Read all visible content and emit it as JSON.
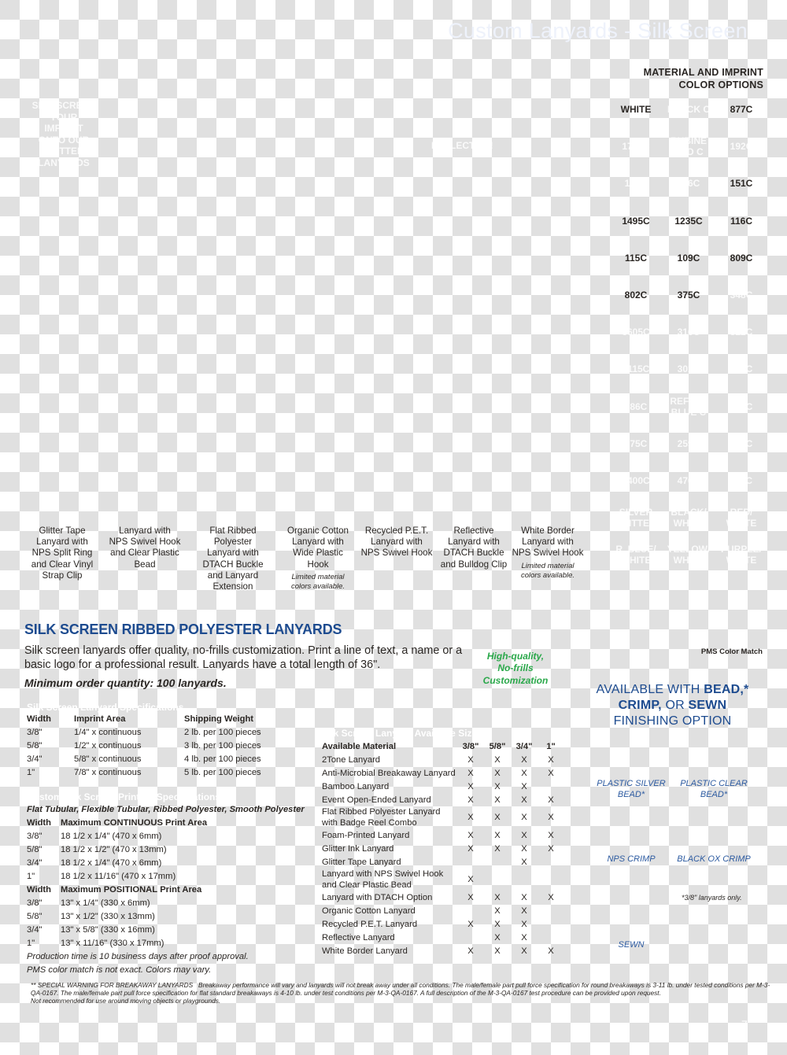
{
  "page_title": "Custom Lanyards - Silk Screen",
  "page_number": "7",
  "side_promo_ghost": [
    "SILK SCREEN",
    "YOUR",
    "IMPRINT",
    "ONTO OUR",
    "GLITTER",
    "LANYARDS"
  ],
  "reflective_ghost": "REFLECTIVE!",
  "color_options": {
    "heading_line1": "MATERIAL AND IMPRINT",
    "heading_line2": "COLOR OPTIONS",
    "rows": [
      [
        {
          "label": "WHITE",
          "visible": true
        },
        {
          "label": "BLACK C",
          "visible": false
        },
        {
          "label": "877C",
          "visible": true
        }
      ],
      [
        {
          "label": "1795C",
          "visible": false
        },
        {
          "label": "RUBINE RED C",
          "visible": false
        },
        {
          "label": "192C",
          "visible": false
        }
      ],
      [
        {
          "label": "187C",
          "visible": false
        },
        {
          "label": "186C",
          "visible": false
        },
        {
          "label": "151C",
          "visible": true
        }
      ],
      [
        {
          "label": "1495C",
          "visible": true
        },
        {
          "label": "1235C",
          "visible": true
        },
        {
          "label": "116C",
          "visible": true
        }
      ],
      [
        {
          "label": "115C",
          "visible": true
        },
        {
          "label": "109C",
          "visible": true
        },
        {
          "label": "809C",
          "visible": true
        }
      ],
      [
        {
          "label": "802C",
          "visible": true
        },
        {
          "label": "375C",
          "visible": true
        },
        {
          "label": "348C",
          "visible": false
        }
      ],
      [
        {
          "label": "5605C",
          "visible": false
        },
        {
          "label": "316C",
          "visible": false
        },
        {
          "label": "322C",
          "visible": false
        }
      ],
      [
        {
          "label": "3115C",
          "visible": false
        },
        {
          "label": "301C",
          "visible": false
        },
        {
          "label": "292C",
          "visible": false
        }
      ],
      [
        {
          "label": "286C",
          "visible": false
        },
        {
          "label": "REFLEX BLUE C",
          "visible": false
        },
        {
          "label": "072C",
          "visible": false
        }
      ],
      [
        {
          "label": "275C",
          "visible": false
        },
        {
          "label": "259C",
          "visible": false
        },
        {
          "label": "268C",
          "visible": false
        }
      ],
      [
        {
          "label": "8400C",
          "visible": false
        },
        {
          "label": "476C",
          "visible": false
        },
        {
          "label": "211C",
          "visible": false
        }
      ],
      [
        {
          "label": "SILVER GLITTER",
          "visible": false
        },
        {
          "label": "BLACK/ WHITE",
          "visible": false
        },
        {
          "label": "RED/ WHITE",
          "visible": false
        }
      ],
      [
        {
          "label": "R. BLUE/ WHITE",
          "visible": false
        },
        {
          "label": "YELLOW/ WHITE",
          "visible": false
        },
        {
          "label": "PURPLE/ WHITE",
          "visible": false
        }
      ]
    ]
  },
  "product_captions": [
    {
      "title": "Glitter Tape Lanyard with NPS Split Ring and Clear Vinyl Strap Clip",
      "note": ""
    },
    {
      "title": "Lanyard with NPS Swivel Hook and Clear Plastic Bead",
      "note": ""
    },
    {
      "title": "Flat Ribbed Polyester Lanyard with DTACH Buckle and Lanyard Extension",
      "note": ""
    },
    {
      "title": "Organic Cotton Lanyard with Wide Plastic Hook",
      "note": "Limited material colors available."
    },
    {
      "title": "Recycled P.E.T. Lanyard with NPS Swivel Hook",
      "note": ""
    },
    {
      "title": "Reflective Lanyard with DTACH Buckle and Bulldog Clip",
      "note": ""
    },
    {
      "title": "White Border Lanyard with NPS Swivel Hook",
      "note": "Limited material colors available."
    }
  ],
  "main": {
    "title": "SILK SCREEN RIBBED POLYESTER LANYARDS",
    "intro": "Silk screen lanyards offer quality, no-frills customization. Print a line of text, a name or a basic logo for a professional result. Lanyards have a total length of 36\".",
    "moq": "Minimum order quantity: 100 lanyards.",
    "tagline": [
      "High-quality,",
      "No-frills",
      "Customization"
    ],
    "tagline_color": "#2aa84a",
    "accent_color": "#1d4b8f",
    "pms_label": "PMS Color Match"
  },
  "specs": {
    "heading_ghost": "Silk Screen Lanyard Specifications",
    "headers": [
      "Width",
      "Imprint Area",
      "Shipping Weight"
    ],
    "rows": [
      [
        "3/8\"",
        "1/4\" x continuous",
        "2 lb. per 100 pieces"
      ],
      [
        "5/8\"",
        "1/2\" x continuous",
        "3 lb. per 100 pieces"
      ],
      [
        "3/4\"",
        "5/8\" x continuous",
        "4 lb. per 100 pieces"
      ],
      [
        "1\"",
        "7/8\" x continuous",
        "5 lb. per 100 pieces"
      ]
    ]
  },
  "printing_specs": {
    "heading_ghost": "Custom Silk Screen Printing Specifications",
    "materials": "Flat Tubular, Flexible Tubular, Ribbed Polyester, Smooth Polyester",
    "continuous": {
      "width_header": "Width",
      "header_pre": "Maximum ",
      "header_bold": "CONTINUOUS",
      "header_post": " Print Area",
      "rows": [
        [
          "3/8\"",
          "18 1/2  x 1/4\" (470 x 6mm)"
        ],
        [
          "5/8\"",
          "18 1/2  x 1/2\" (470 x 13mm)"
        ],
        [
          "3/4\"",
          "18 1/2  x 1/4\" (470 x 6mm)"
        ],
        [
          "1\"",
          "18 1/2  x 11/16\" (470 x 17mm)"
        ]
      ]
    },
    "positional": {
      "width_header": "Width",
      "header_pre": "Maximum ",
      "header_bold": "POSITIONAL",
      "header_post": " Print Area",
      "rows": [
        [
          "3/8\"",
          "13\" x 1/4\" (330 x 6mm)"
        ],
        [
          "5/8\"",
          "13\" x 1/2\" (330 x 13mm)"
        ],
        [
          "3/4\"",
          "13\" x  5/8\" (330 x 16mm)"
        ],
        [
          "1\"",
          "13\" x 11/16\" (330 x 17mm)"
        ]
      ]
    },
    "production_note": "Production time is 10 business days after proof approval.",
    "color_note": "PMS color match is not exact. Colors may vary."
  },
  "sizes": {
    "heading_ghost": "Silk Screen Lanyard Available Sizes",
    "headers": [
      "Available Material",
      "3/8\"",
      "5/8\"",
      "3/4\"",
      "1\""
    ],
    "rows": [
      [
        "2Tone Lanyard",
        "X",
        "X",
        "X",
        "X"
      ],
      [
        "Anti-Microbial Breakaway Lanyard",
        "X",
        "X",
        "X",
        "X"
      ],
      [
        "Bamboo Lanyard",
        "X",
        "X",
        "X",
        ""
      ],
      [
        "Event Open-Ended Lanyard",
        "X",
        "X",
        "X",
        "X"
      ],
      [
        "Flat Ribbed Polyester Lanyard with Badge Reel Combo",
        "X",
        "X",
        "X",
        "X"
      ],
      [
        "Foam-Printed Lanyard",
        "X",
        "X",
        "X",
        "X"
      ],
      [
        "Glitter Ink Lanyard",
        "X",
        "X",
        "X",
        "X"
      ],
      [
        "Glitter Tape Lanyard",
        "",
        "",
        "X",
        ""
      ],
      [
        "Lanyard with NPS Swivel Hook and Clear Plastic Bead",
        "X",
        "",
        "",
        ""
      ],
      [
        "Lanyard with DTACH Option",
        "X",
        "X",
        "X",
        "X"
      ],
      [
        "Organic Cotton Lanyard",
        "",
        "X",
        "X",
        ""
      ],
      [
        "Recycled P.E.T. Lanyard",
        "X",
        "X",
        "X",
        ""
      ],
      [
        "Reflective Lanyard",
        "",
        "X",
        "X",
        ""
      ],
      [
        "White Border Lanyard",
        "X",
        "X",
        "X",
        "X"
      ]
    ]
  },
  "finishing": {
    "heading_1a": "AVAILABLE WITH ",
    "heading_1b": "BEAD,*",
    "heading_2a": "CRIMP,",
    "heading_2b": " OR ",
    "heading_2c": "SEWN",
    "heading_3": "FINISHING OPTION",
    "items": [
      "PLASTIC SILVER BEAD*",
      "PLASTIC CLEAR BEAD*",
      "NPS CRIMP",
      "BLACK OX CRIMP",
      "SEWN"
    ],
    "bead_note": "*3/8\" lanyards only."
  },
  "footnote": {
    "lead": "**  SPECIAL WARNING FOR BREAKAWAY LANYARDS",
    "body": "Breakaway performance will vary and lanyards will not break away under all conditions. The male/female part pull force specification for round breakaways is 3-11 lb. under tested conditions per M-3-QA-0167. The male/female part pull force specification for flat standard breakaways is 4-10 lb. under test conditions per M-3-QA-0167. A full description of the M-3-QA-0167 test procedure can be provided upon request.",
    "tail": "Not recommended for use around moving objects or playgrounds."
  }
}
